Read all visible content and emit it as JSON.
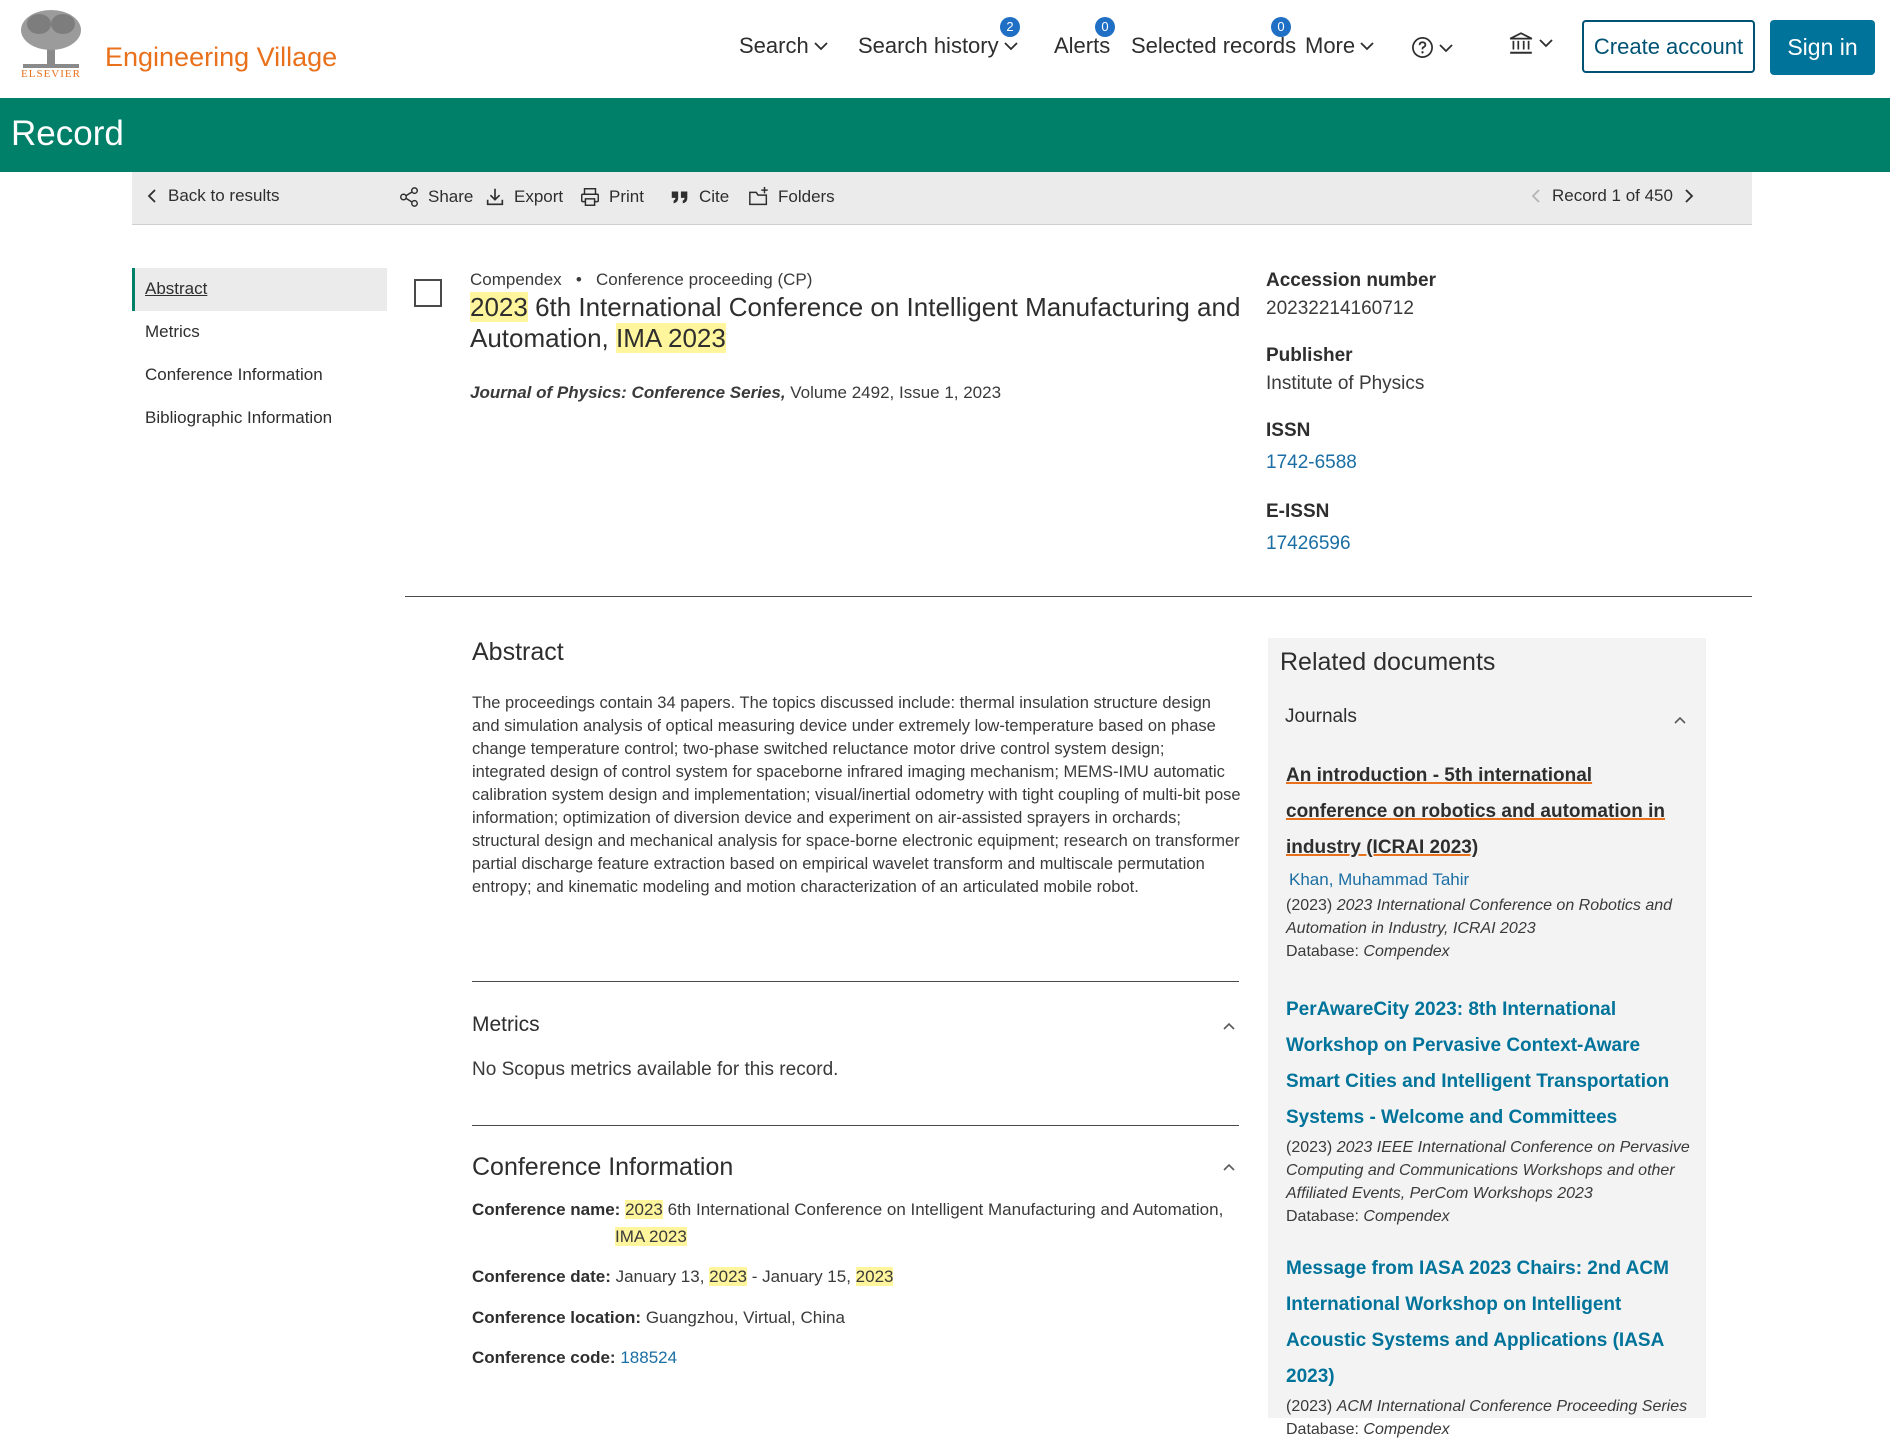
{
  "header": {
    "publisher_word": "ELSEVIER",
    "brand": "Engineering Village",
    "nav": {
      "search": "Search",
      "search_history": "Search history",
      "search_history_badge": "2",
      "alerts": "Alerts",
      "alerts_badge": "0",
      "selected_records": "Selected records",
      "selected_records_badge": "0",
      "more": "More"
    },
    "create_account": "Create account",
    "sign_in": "Sign in"
  },
  "banner": {
    "title": "Record"
  },
  "toolbar": {
    "back": "Back to results",
    "share": "Share",
    "export": "Export",
    "print": "Print",
    "cite": "Cite",
    "folders": "Folders",
    "record_counter": "Record 1 of 450"
  },
  "leftnav": [
    "Abstract",
    "Metrics",
    "Conference Information",
    "Bibliographic Information"
  ],
  "record": {
    "database": "Compendex",
    "doc_type": "Conference proceeding (CP)",
    "title_hl1": "2023",
    "title_mid": " 6th International Conference on Intelligent Manufacturing and Automation, ",
    "title_hl2": "IMA 2023",
    "journal": "Journal of Physics: Conference Series,",
    "journal_rest": " Volume 2492, Issue 1, 2023"
  },
  "meta": {
    "accession_label": "Accession number",
    "accession_value": "20232214160712",
    "publisher_label": "Publisher",
    "publisher_value": "Institute of Physics",
    "issn_label": "ISSN",
    "issn_value": "1742-6588",
    "eissn_label": "E-ISSN",
    "eissn_value": "17426596"
  },
  "abstract": {
    "heading": "Abstract",
    "text": "The proceedings contain 34 papers. The topics discussed include: thermal insulation structure design and simulation analysis of optical measuring device under extremely low-temperature based on phase change temperature control; two-phase switched reluctance motor drive control system design; integrated design of control system for spaceborne infrared imaging mechanism; MEMS-IMU automatic calibration system design and implementation; visual/inertial odometry with tight coupling of multi-bit pose information; optimization of diversion device and experiment on air-assisted sprayers in orchards; structural design and mechanical analysis for space-borne electronic equipment; research on transformer partial discharge feature extraction based on empirical wavelet transform and multiscale permutation entropy; and kinematic modeling and motion characterization of an articulated mobile robot."
  },
  "metrics": {
    "heading": "Metrics",
    "text": "No Scopus metrics available for this record."
  },
  "conference": {
    "heading": "Conference Information",
    "name_label": "Conference name:",
    "name_hl1": "2023",
    "name_mid": " 6th International Conference on Intelligent Manufacturing and Automation,",
    "name_hl2": "IMA 2023",
    "date_label": "Conference date:",
    "date_part1": " January 13, ",
    "date_hl1": "2023",
    "date_part2": " - January 15, ",
    "date_hl2": "2023",
    "location_label": "Conference location:",
    "location_value": " Guangzhou, Virtual, China",
    "code_label": "Conference code:",
    "code_value": "188524"
  },
  "related": {
    "heading": "Related documents",
    "subheading": "Journals",
    "items": [
      {
        "title": "An introduction - 5th international conference on robotics and automation in industry (ICRAI 2023)",
        "author": "Khan, Muhammad Tahir",
        "year": "(2023) ",
        "source": "2023 International Conference on Robotics and Automation in Industry, ICRAI 2023",
        "db_label": "Database: ",
        "db": "Compendex"
      },
      {
        "title": "PerAwareCity 2023: 8th International Workshop on Pervasive Context-Aware Smart Cities and Intelligent Transportation Systems - Welcome and Committees",
        "year": "(2023) ",
        "source": "2023 IEEE International Conference on Pervasive Computing and Communications Workshops and other Affiliated Events, PerCom Workshops 2023",
        "db_label": "Database: ",
        "db": "Compendex"
      },
      {
        "title": "Message from IASA 2023 Chairs: 2nd ACM International Workshop on Intelligent Acoustic Systems and Applications (IASA 2023)",
        "year": "(2023) ",
        "source": "ACM International Conference Proceeding Series",
        "db_label": "Database: ",
        "db": "Compendex"
      }
    ]
  }
}
